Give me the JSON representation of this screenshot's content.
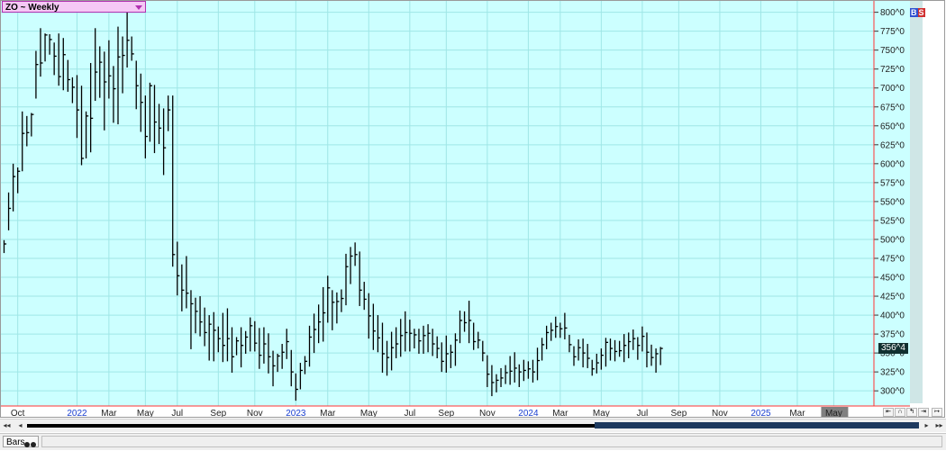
{
  "title": "ZO ~ Weekly",
  "status": {
    "tab_label": "Bars"
  },
  "indicators": {
    "b": "B",
    "s": "S"
  },
  "colors": {
    "background": "#ccffff",
    "grid": "#9fe6e6",
    "bars": "#000000",
    "axis_line": "#ff3333",
    "last_price_bg": "#103030"
  },
  "chart_data": {
    "type": "ohlc",
    "title": "ZO ~ Weekly",
    "ylim": [
      280,
      815
    ],
    "yticks": [
      {
        "value": 800,
        "label": "800^0"
      },
      {
        "value": 775,
        "label": "775^0"
      },
      {
        "value": 750,
        "label": "750^0"
      },
      {
        "value": 725,
        "label": "725^0"
      },
      {
        "value": 700,
        "label": "700^0"
      },
      {
        "value": 675,
        "label": "675^0"
      },
      {
        "value": 650,
        "label": "650^0"
      },
      {
        "value": 625,
        "label": "625^0"
      },
      {
        "value": 600,
        "label": "600^0"
      },
      {
        "value": 575,
        "label": "575^0"
      },
      {
        "value": 550,
        "label": "550^0"
      },
      {
        "value": 525,
        "label": "525^0"
      },
      {
        "value": 500,
        "label": "500^0"
      },
      {
        "value": 475,
        "label": "475^0"
      },
      {
        "value": 450,
        "label": "450^0"
      },
      {
        "value": 425,
        "label": "425^0"
      },
      {
        "value": 400,
        "label": "400^0"
      },
      {
        "value": 375,
        "label": "375^0"
      },
      {
        "value": 350,
        "label": "350^0"
      },
      {
        "value": 325,
        "label": "325^0"
      },
      {
        "value": 300,
        "label": "300^0"
      }
    ],
    "xlabels": [
      {
        "label": "Oct",
        "i": 3,
        "year": false
      },
      {
        "label": "2022",
        "i": 16,
        "year": true
      },
      {
        "label": "Mar",
        "i": 23,
        "year": false
      },
      {
        "label": "May",
        "i": 31,
        "year": false
      },
      {
        "label": "Jul",
        "i": 38,
        "year": false
      },
      {
        "label": "Sep",
        "i": 47,
        "year": false
      },
      {
        "label": "Nov",
        "i": 55,
        "year": false
      },
      {
        "label": "2023",
        "i": 64,
        "year": true
      },
      {
        "label": "Mar",
        "i": 71,
        "year": false
      },
      {
        "label": "May",
        "i": 80,
        "year": false
      },
      {
        "label": "Jul",
        "i": 89,
        "year": false
      },
      {
        "label": "Sep",
        "i": 97,
        "year": false
      },
      {
        "label": "Nov",
        "i": 106,
        "year": false
      },
      {
        "label": "2024",
        "i": 115,
        "year": true
      },
      {
        "label": "Mar",
        "i": 122,
        "year": false
      },
      {
        "label": "May",
        "i": 131,
        "year": false
      },
      {
        "label": "Jul",
        "i": 140,
        "year": false
      },
      {
        "label": "Sep",
        "i": 148,
        "year": false
      },
      {
        "label": "Nov",
        "i": 157,
        "year": false
      },
      {
        "label": "2025",
        "i": 166,
        "year": true
      },
      {
        "label": "Mar",
        "i": 174,
        "year": false
      },
      {
        "label": "May",
        "i": 182,
        "year": false
      }
    ],
    "last_price": {
      "value": 356.5,
      "label": "356^4"
    },
    "grid": true,
    "bars_hlc": [
      [
        499,
        482,
        494
      ],
      [
        562,
        512,
        541
      ],
      [
        600,
        537,
        583
      ],
      [
        595,
        561,
        590
      ],
      [
        669,
        590,
        640
      ],
      [
        663,
        623,
        641
      ],
      [
        667,
        636,
        665
      ],
      [
        749,
        686,
        731
      ],
      [
        779,
        715,
        733
      ],
      [
        772,
        735,
        770
      ],
      [
        771,
        744,
        764
      ],
      [
        760,
        717,
        742
      ],
      [
        772,
        703,
        715
      ],
      [
        766,
        697,
        744
      ],
      [
        737,
        695,
        711
      ],
      [
        714,
        680,
        701
      ],
      [
        717,
        634,
        671
      ],
      [
        703,
        598,
        607
      ],
      [
        669,
        607,
        663
      ],
      [
        733,
        615,
        660
      ],
      [
        779,
        683,
        721
      ],
      [
        755,
        687,
        734
      ],
      [
        748,
        644,
        708
      ],
      [
        763,
        686,
        716
      ],
      [
        729,
        654,
        699
      ],
      [
        781,
        652,
        741
      ],
      [
        768,
        693,
        743
      ],
      [
        812,
        727,
        763
      ],
      [
        768,
        736,
        745
      ],
      [
        736,
        672,
        703
      ],
      [
        719,
        642,
        681
      ],
      [
        690,
        607,
        636
      ],
      [
        707,
        629,
        703
      ],
      [
        704,
        614,
        655
      ],
      [
        679,
        626,
        647
      ],
      [
        673,
        585,
        621
      ],
      [
        690,
        643,
        671
      ],
      [
        690,
        464,
        480
      ],
      [
        497,
        426,
        452
      ],
      [
        467,
        405,
        433
      ],
      [
        478,
        409,
        429
      ],
      [
        433,
        355,
        415
      ],
      [
        423,
        376,
        405
      ],
      [
        425,
        372,
        391
      ],
      [
        410,
        359,
        377
      ],
      [
        400,
        340,
        388
      ],
      [
        404,
        339,
        380
      ],
      [
        385,
        351,
        369
      ],
      [
        403,
        338,
        360
      ],
      [
        409,
        339,
        369
      ],
      [
        384,
        324,
        345
      ],
      [
        371,
        347,
        366
      ],
      [
        384,
        331,
        360
      ],
      [
        379,
        349,
        371
      ],
      [
        397,
        352,
        386
      ],
      [
        392,
        352,
        363
      ],
      [
        383,
        329,
        347
      ],
      [
        384,
        336,
        362
      ],
      [
        376,
        323,
        345
      ],
      [
        353,
        306,
        333
      ],
      [
        349,
        325,
        346
      ],
      [
        362,
        329,
        351
      ],
      [
        382,
        342,
        365
      ],
      [
        354,
        306,
        325
      ],
      [
        323,
        287,
        302
      ],
      [
        337,
        302,
        327
      ],
      [
        346,
        322,
        339
      ],
      [
        386,
        332,
        371
      ],
      [
        402,
        350,
        381
      ],
      [
        414,
        363,
        391
      ],
      [
        437,
        365,
        403
      ],
      [
        452,
        390,
        436
      ],
      [
        433,
        380,
        417
      ],
      [
        430,
        389,
        418
      ],
      [
        434,
        404,
        422
      ],
      [
        481,
        413,
        464
      ],
      [
        490,
        441,
        478
      ],
      [
        496,
        465,
        480
      ],
      [
        484,
        412,
        433
      ],
      [
        444,
        407,
        421
      ],
      [
        429,
        369,
        399
      ],
      [
        415,
        354,
        379
      ],
      [
        400,
        351,
        370
      ],
      [
        390,
        324,
        349
      ],
      [
        366,
        320,
        344
      ],
      [
        378,
        327,
        357
      ],
      [
        384,
        343,
        362
      ],
      [
        395,
        345,
        373
      ],
      [
        405,
        352,
        377
      ],
      [
        394,
        352,
        376
      ],
      [
        382,
        356,
        374
      ],
      [
        382,
        349,
        366
      ],
      [
        386,
        349,
        373
      ],
      [
        388,
        351,
        376
      ],
      [
        382,
        346,
        362
      ],
      [
        372,
        343,
        356
      ],
      [
        364,
        325,
        339
      ],
      [
        373,
        324,
        349
      ],
      [
        361,
        330,
        351
      ],
      [
        376,
        333,
        367
      ],
      [
        406,
        363,
        393
      ],
      [
        405,
        378,
        390
      ],
      [
        419,
        363,
        393
      ],
      [
        390,
        354,
        365
      ],
      [
        378,
        356,
        367
      ],
      [
        366,
        339,
        350
      ],
      [
        347,
        305,
        322
      ],
      [
        334,
        293,
        311
      ],
      [
        322,
        298,
        314
      ],
      [
        330,
        305,
        317
      ],
      [
        334,
        309,
        324
      ],
      [
        346,
        308,
        326
      ],
      [
        351,
        311,
        330
      ],
      [
        335,
        305,
        325
      ],
      [
        341,
        313,
        327
      ],
      [
        339,
        316,
        329
      ],
      [
        341,
        311,
        325
      ],
      [
        357,
        314,
        340
      ],
      [
        370,
        340,
        361
      ],
      [
        386,
        355,
        377
      ],
      [
        390,
        366,
        380
      ],
      [
        398,
        370,
        385
      ],
      [
        390,
        370,
        382
      ],
      [
        403,
        368,
        383
      ],
      [
        374,
        351,
        361
      ],
      [
        359,
        333,
        345
      ],
      [
        368,
        340,
        357
      ],
      [
        369,
        331,
        350
      ],
      [
        362,
        330,
        343
      ],
      [
        341,
        320,
        329
      ],
      [
        349,
        323,
        337
      ],
      [
        356,
        328,
        347
      ],
      [
        370,
        332,
        364
      ],
      [
        369,
        340,
        356
      ],
      [
        367,
        339,
        352
      ],
      [
        366,
        345,
        353
      ],
      [
        375,
        338,
        360
      ],
      [
        377,
        343,
        365
      ],
      [
        381,
        354,
        369
      ],
      [
        371,
        341,
        360
      ],
      [
        385,
        352,
        372
      ],
      [
        377,
        331,
        351
      ],
      [
        361,
        333,
        344
      ],
      [
        356,
        324,
        349
      ],
      [
        358,
        334,
        356
      ]
    ]
  }
}
